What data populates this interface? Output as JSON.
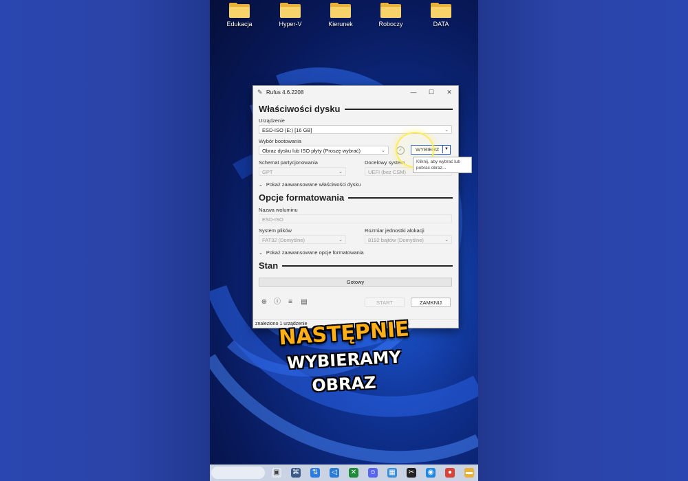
{
  "desktop": {
    "icons": [
      {
        "label": "Edukacja",
        "icon": "folder-icon"
      },
      {
        "label": "Hyper-V",
        "icon": "folder-icon"
      },
      {
        "label": "Kierunek",
        "icon": "folder-icon"
      },
      {
        "label": "Roboczy",
        "icon": "folder-icon"
      },
      {
        "label": "DATA",
        "icon": "folder-icon"
      }
    ]
  },
  "window": {
    "title": "Rufus 4.6.2208",
    "controls": {
      "minimize": "—",
      "maximize": "☐",
      "close": "✕"
    }
  },
  "drive_properties": {
    "heading": "Właściwości dysku",
    "device_label": "Urządzenie",
    "device_value": "ESD-ISO (E:) [16 GB]",
    "boot_label": "Wybór bootowania",
    "boot_value": "Obraz dysku lub ISO płyty (Proszę wybrać)",
    "select_button": "WYBIERZ",
    "partition_label": "Schemat partycjonowania",
    "partition_value": "GPT",
    "target_label": "Docelowy system",
    "target_value": "UEFI (bez CSM)",
    "advanced_toggle": "Pokaż zaawansowane właściwości dysku"
  },
  "tooltip": {
    "line1": "Kliknij, aby wybrać lub",
    "line2": "pobrać obraz..."
  },
  "format_options": {
    "heading": "Opcje formatowania",
    "volume_label": "Nazwa woluminu",
    "volume_value": "ESD-ISO",
    "fs_label": "System plików",
    "fs_value": "FAT32 (Domyślne)",
    "cluster_label": "Rozmiar jednostki alokacji",
    "cluster_value": "8192 bajtów (Domyślne)",
    "advanced_toggle": "Pokaż zaawansowane opcje formatowania"
  },
  "status": {
    "heading": "Stan",
    "progress_text": "Gotowy",
    "start_button": "START",
    "close_button": "ZAMKNIJ",
    "statusbar": "znaleziono 1 urządzenie"
  },
  "caption": {
    "line1": "NASTĘPNIE",
    "line2": "WYBIERAMY",
    "line3": "OBRAZ"
  },
  "colors": {
    "accent": "#2b5bd6",
    "caption_orange": "#ffb019"
  }
}
